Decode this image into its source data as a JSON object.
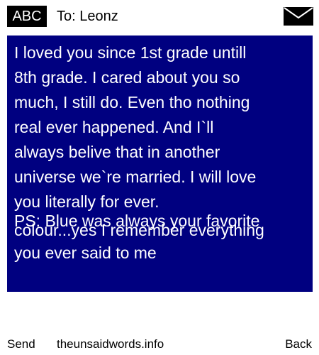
{
  "header": {
    "badge_label": "ABC",
    "recipient": "To: Leonz",
    "icon": "envelope-icon"
  },
  "message": {
    "lines": [
      "I loved you since 1st grade untill",
      "8th grade. I cared about you so",
      "much, I still do. Even tho nothing",
      "real ever happened. And I`ll",
      "always belive that in another",
      "universe we`re married. I will love",
      "you literally for ever.",
      "PS: Blue was always your favorite",
      "colour...yes I remember everything",
      "you ever said to me"
    ],
    "background_color": "#000080",
    "text_color": "#ffffff"
  },
  "footer": {
    "send_label": "Send",
    "site_label": "theunsaidwords.info",
    "back_label": "Back"
  }
}
